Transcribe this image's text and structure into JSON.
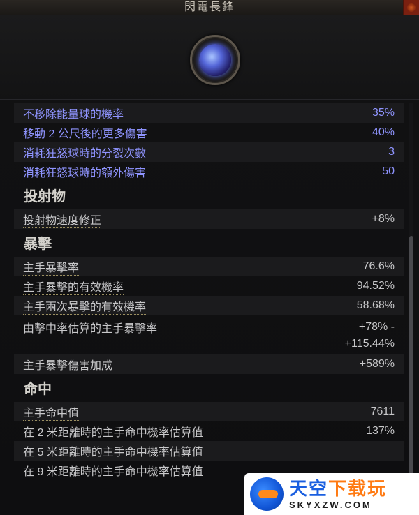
{
  "window": {
    "title": "閃電長鋒"
  },
  "icons": {
    "close": "close-icon",
    "skill": "lightning-spear-skill-icon",
    "watermark": "site-logo-icon"
  },
  "colors": {
    "modifier_text": "#8f94ff",
    "stat_text": "#c8c8ca",
    "section_text": "#d4d2cc"
  },
  "modifiers": [
    {
      "label": "不移除能量球的機率",
      "value": "35%"
    },
    {
      "label": "移動 2 公尺後的更多傷害",
      "value": "40%"
    },
    {
      "label": "消耗狂怒球時的分裂次數",
      "value": "3"
    },
    {
      "label": "消耗狂怒球時的額外傷害",
      "value": "50"
    }
  ],
  "sections": {
    "projectile": {
      "title": "投射物",
      "rows": [
        {
          "label": "投射物速度修正",
          "value": "+8%"
        }
      ]
    },
    "critical": {
      "title": "暴擊",
      "rows": [
        {
          "label": "主手暴擊率",
          "value": "76.6%"
        },
        {
          "label": "主手暴擊的有效機率",
          "value": "94.52%"
        },
        {
          "label": "主手兩次暴擊的有效機率",
          "value": "58.68%"
        },
        {
          "label": "由擊中率估算的主手暴擊率",
          "value_line1": "+78% -",
          "value_line2": "+115.44%"
        },
        {
          "label": "主手暴擊傷害加成",
          "value": "+589%"
        }
      ]
    },
    "accuracy": {
      "title": "命中",
      "rows": [
        {
          "label": "主手命中值",
          "value": "7611"
        },
        {
          "label": "在 2 米距離時的主手命中機率估算值",
          "value": "137%"
        },
        {
          "label": "在 5 米距離時的主手命中機率估算值",
          "value": ""
        },
        {
          "label": "在 9 米距離時的主手命中機率估算值",
          "value": ""
        }
      ]
    }
  },
  "watermark": {
    "name_blue": "天空",
    "name_orange": "下载玩",
    "url": "SKYXZW.COM"
  }
}
